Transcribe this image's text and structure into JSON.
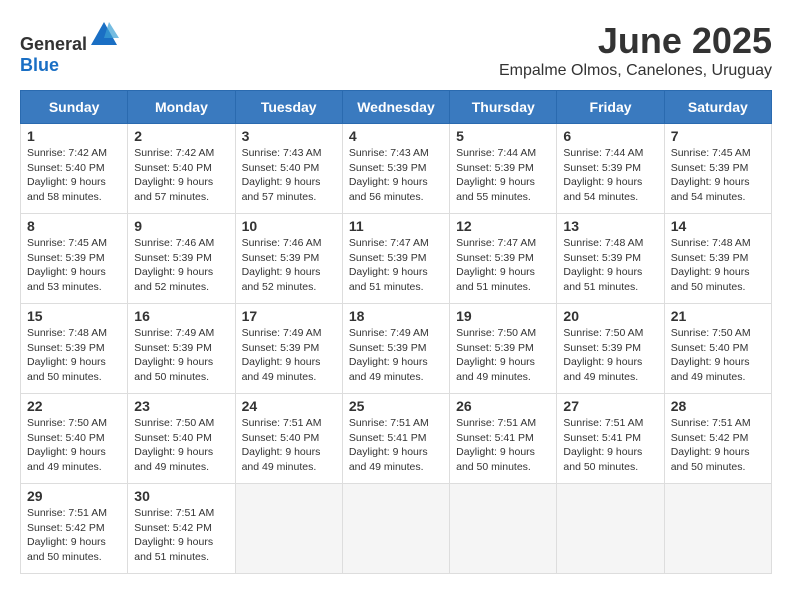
{
  "header": {
    "logo_general": "General",
    "logo_blue": "Blue",
    "month_year": "June 2025",
    "location": "Empalme Olmos, Canelones, Uruguay"
  },
  "weekdays": [
    "Sunday",
    "Monday",
    "Tuesday",
    "Wednesday",
    "Thursday",
    "Friday",
    "Saturday"
  ],
  "weeks": [
    [
      {
        "day": "1",
        "info": "Sunrise: 7:42 AM\nSunset: 5:40 PM\nDaylight: 9 hours\nand 58 minutes."
      },
      {
        "day": "2",
        "info": "Sunrise: 7:42 AM\nSunset: 5:40 PM\nDaylight: 9 hours\nand 57 minutes."
      },
      {
        "day": "3",
        "info": "Sunrise: 7:43 AM\nSunset: 5:40 PM\nDaylight: 9 hours\nand 57 minutes."
      },
      {
        "day": "4",
        "info": "Sunrise: 7:43 AM\nSunset: 5:39 PM\nDaylight: 9 hours\nand 56 minutes."
      },
      {
        "day": "5",
        "info": "Sunrise: 7:44 AM\nSunset: 5:39 PM\nDaylight: 9 hours\nand 55 minutes."
      },
      {
        "day": "6",
        "info": "Sunrise: 7:44 AM\nSunset: 5:39 PM\nDaylight: 9 hours\nand 54 minutes."
      },
      {
        "day": "7",
        "info": "Sunrise: 7:45 AM\nSunset: 5:39 PM\nDaylight: 9 hours\nand 54 minutes."
      }
    ],
    [
      {
        "day": "8",
        "info": "Sunrise: 7:45 AM\nSunset: 5:39 PM\nDaylight: 9 hours\nand 53 minutes."
      },
      {
        "day": "9",
        "info": "Sunrise: 7:46 AM\nSunset: 5:39 PM\nDaylight: 9 hours\nand 52 minutes."
      },
      {
        "day": "10",
        "info": "Sunrise: 7:46 AM\nSunset: 5:39 PM\nDaylight: 9 hours\nand 52 minutes."
      },
      {
        "day": "11",
        "info": "Sunrise: 7:47 AM\nSunset: 5:39 PM\nDaylight: 9 hours\nand 51 minutes."
      },
      {
        "day": "12",
        "info": "Sunrise: 7:47 AM\nSunset: 5:39 PM\nDaylight: 9 hours\nand 51 minutes."
      },
      {
        "day": "13",
        "info": "Sunrise: 7:48 AM\nSunset: 5:39 PM\nDaylight: 9 hours\nand 51 minutes."
      },
      {
        "day": "14",
        "info": "Sunrise: 7:48 AM\nSunset: 5:39 PM\nDaylight: 9 hours\nand 50 minutes."
      }
    ],
    [
      {
        "day": "15",
        "info": "Sunrise: 7:48 AM\nSunset: 5:39 PM\nDaylight: 9 hours\nand 50 minutes."
      },
      {
        "day": "16",
        "info": "Sunrise: 7:49 AM\nSunset: 5:39 PM\nDaylight: 9 hours\nand 50 minutes."
      },
      {
        "day": "17",
        "info": "Sunrise: 7:49 AM\nSunset: 5:39 PM\nDaylight: 9 hours\nand 49 minutes."
      },
      {
        "day": "18",
        "info": "Sunrise: 7:49 AM\nSunset: 5:39 PM\nDaylight: 9 hours\nand 49 minutes."
      },
      {
        "day": "19",
        "info": "Sunrise: 7:50 AM\nSunset: 5:39 PM\nDaylight: 9 hours\nand 49 minutes."
      },
      {
        "day": "20",
        "info": "Sunrise: 7:50 AM\nSunset: 5:39 PM\nDaylight: 9 hours\nand 49 minutes."
      },
      {
        "day": "21",
        "info": "Sunrise: 7:50 AM\nSunset: 5:40 PM\nDaylight: 9 hours\nand 49 minutes."
      }
    ],
    [
      {
        "day": "22",
        "info": "Sunrise: 7:50 AM\nSunset: 5:40 PM\nDaylight: 9 hours\nand 49 minutes."
      },
      {
        "day": "23",
        "info": "Sunrise: 7:50 AM\nSunset: 5:40 PM\nDaylight: 9 hours\nand 49 minutes."
      },
      {
        "day": "24",
        "info": "Sunrise: 7:51 AM\nSunset: 5:40 PM\nDaylight: 9 hours\nand 49 minutes."
      },
      {
        "day": "25",
        "info": "Sunrise: 7:51 AM\nSunset: 5:41 PM\nDaylight: 9 hours\nand 49 minutes."
      },
      {
        "day": "26",
        "info": "Sunrise: 7:51 AM\nSunset: 5:41 PM\nDaylight: 9 hours\nand 50 minutes."
      },
      {
        "day": "27",
        "info": "Sunrise: 7:51 AM\nSunset: 5:41 PM\nDaylight: 9 hours\nand 50 minutes."
      },
      {
        "day": "28",
        "info": "Sunrise: 7:51 AM\nSunset: 5:42 PM\nDaylight: 9 hours\nand 50 minutes."
      }
    ],
    [
      {
        "day": "29",
        "info": "Sunrise: 7:51 AM\nSunset: 5:42 PM\nDaylight: 9 hours\nand 50 minutes."
      },
      {
        "day": "30",
        "info": "Sunrise: 7:51 AM\nSunset: 5:42 PM\nDaylight: 9 hours\nand 51 minutes."
      },
      {
        "day": "",
        "info": ""
      },
      {
        "day": "",
        "info": ""
      },
      {
        "day": "",
        "info": ""
      },
      {
        "day": "",
        "info": ""
      },
      {
        "day": "",
        "info": ""
      }
    ]
  ]
}
